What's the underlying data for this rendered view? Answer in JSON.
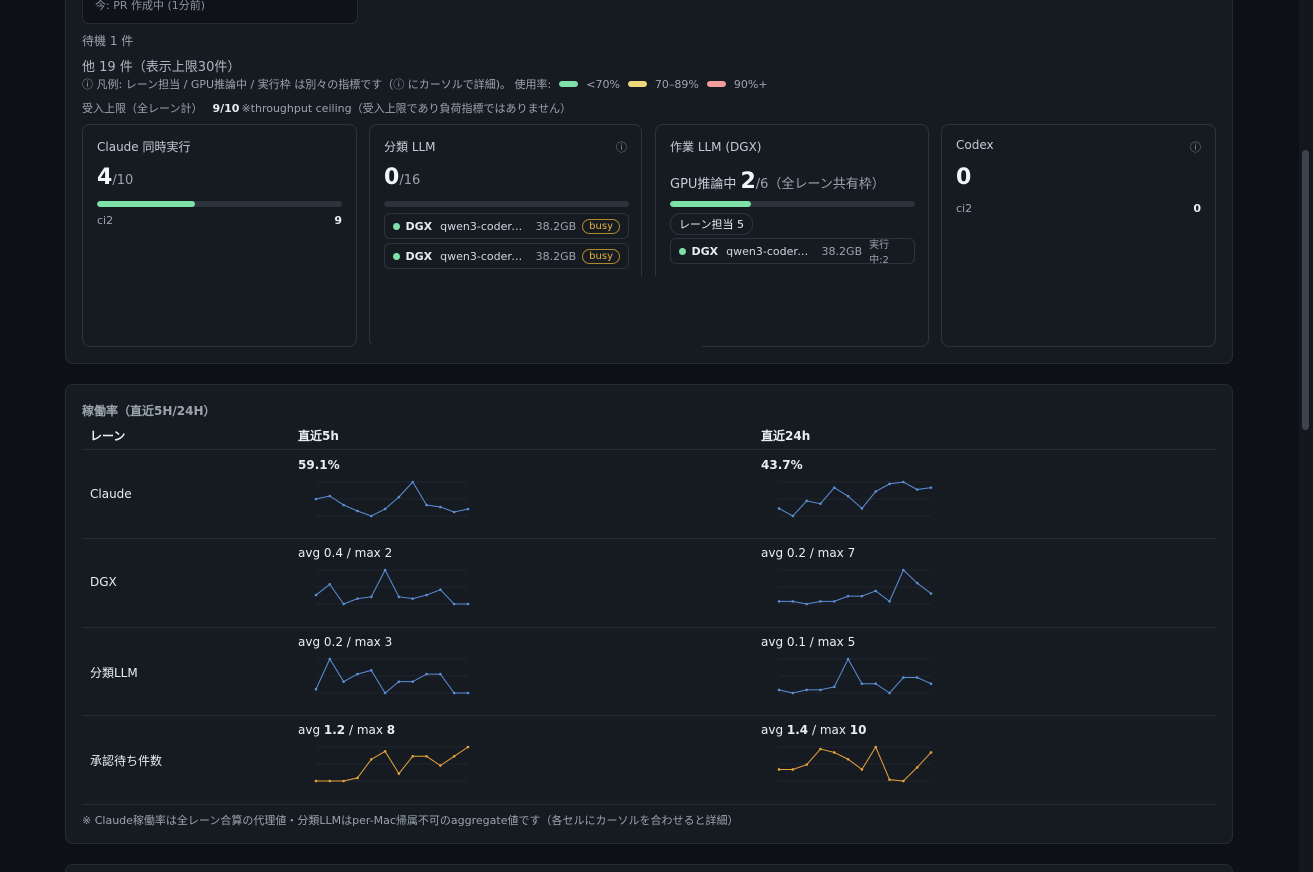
{
  "header": {
    "recent_activity": "今: PR 作成中 (1分前)",
    "waiting": "待機 1 件",
    "others": "他 19 件（表示上限30件）",
    "legend_prefix": "ⓘ  凡例: レーン担当 / GPU推論中 / 実行枠 は別々の指標です（ⓘ にカーソルで詳細)。 使用率:",
    "legend": [
      {
        "label": "<70%",
        "color": "#7ee2a8"
      },
      {
        "label": "70–89%",
        "color": "#f0d77a"
      },
      {
        "label": "90%+",
        "color": "#f29b9b"
      }
    ],
    "ceiling_label": "受入上限（全レーン計）",
    "ceiling_value": "9/10",
    "ceiling_note": "※throughput ceiling（受入上限であり負荷指標ではありません）"
  },
  "cards": {
    "claude": {
      "title": "Claude 同時実行",
      "value": "4",
      "max": "/10",
      "fill": 0.4,
      "sub_label": "ci2",
      "sub_value": "9"
    },
    "classify": {
      "title": "分類 LLM",
      "info": "ⓘ",
      "value": "0",
      "max": "/16",
      "fill": 0,
      "models": [
        {
          "host": "DGX",
          "name": "qwen3-coder-w...",
          "size": "38.2GB",
          "badge": "busy"
        },
        {
          "host": "DGX",
          "name": "qwen3-coder-w...",
          "size": "38.2GB",
          "badge": "busy"
        }
      ]
    },
    "work": {
      "title": "作業 LLM (DGX)",
      "gpu_label": "GPU推論中",
      "value": "2",
      "max": "/6（全レーン共有枠）",
      "fill": 0.33,
      "lane_chip": "レーン担当 5",
      "model": {
        "host": "DGX",
        "name": "qwen3-coder-w...",
        "size": "38.2GB",
        "running": "実行中:2"
      }
    },
    "codex": {
      "title": "Codex",
      "info": "ⓘ",
      "value": "0",
      "sub_label": "ci2",
      "sub_value": "0"
    }
  },
  "utilization": {
    "title": "稼働率（直近5H/24H）",
    "columns": {
      "lane": "レーン",
      "h5": "直近5h",
      "h24": "直近24h"
    },
    "rows": [
      {
        "lane": "Claude",
        "h5": "59.1%",
        "h24": "43.7%"
      },
      {
        "lane": "DGX",
        "h5": "avg 0.4 / max 2",
        "h24": "avg 0.2 / max 7"
      },
      {
        "lane": "分類LLM",
        "h5": "avg 0.2 / max 3",
        "h24": "avg 0.1 / max 5"
      },
      {
        "lane": "承認待ち件数",
        "h5_avg_label": "avg ",
        "h5_avg": "1.2",
        "h5_sep": " / max ",
        "h5_max": "8",
        "h24_avg_label": "avg ",
        "h24_avg": "1.4",
        "h24_sep": " / max ",
        "h24_max": "10"
      }
    ],
    "sparklines": {
      "claude_5h": {
        "color": "#5b8fd6",
        "values": [
          58,
          61,
          52,
          46,
          41,
          48,
          60,
          75,
          52,
          50,
          45,
          48
        ]
      },
      "claude_24h": {
        "color": "#5b8fd6",
        "values": [
          30,
          22,
          38,
          35,
          52,
          43,
          30,
          48,
          56,
          58,
          50,
          52
        ]
      },
      "dgx_5h": {
        "color": "#5b8fd6",
        "values": [
          0.3,
          0.6,
          0.05,
          0.2,
          0.25,
          1.0,
          0.25,
          0.2,
          0.3,
          0.45,
          0.05,
          0.05
        ]
      },
      "dgx_24h": {
        "color": "#5b8fd6",
        "values": [
          0.1,
          0.1,
          0.05,
          0.1,
          0.1,
          0.2,
          0.2,
          0.3,
          0.1,
          0.7,
          0.45,
          0.25
        ]
      },
      "cls_5h": {
        "color": "#5b8fd6",
        "values": [
          0.1,
          0.5,
          0.2,
          0.3,
          0.35,
          0.05,
          0.2,
          0.2,
          0.3,
          0.3,
          0.05,
          0.05
        ]
      },
      "cls_24h": {
        "color": "#5b8fd6",
        "values": [
          0.05,
          0.0,
          0.05,
          0.05,
          0.1,
          0.55,
          0.15,
          0.15,
          0.0,
          0.25,
          0.25,
          0.15
        ]
      },
      "approve_5h": {
        "color": "#e8a33b",
        "values": [
          0,
          0,
          0,
          0.5,
          3.5,
          4.8,
          1.2,
          4,
          4,
          2.5,
          4,
          5.5
        ]
      },
      "approve_24h": {
        "color": "#e8a33b",
        "values": [
          2.5,
          2.5,
          3.2,
          5.5,
          5,
          4,
          2.5,
          5.8,
          1,
          0.8,
          2.8,
          5
        ]
      }
    },
    "footnote": "※ Claude稼働率は全レーン合算の代理値・分類LLMはper-Mac帰属不可のaggregate値です（各セルにカーソルを合わせると詳細）"
  }
}
